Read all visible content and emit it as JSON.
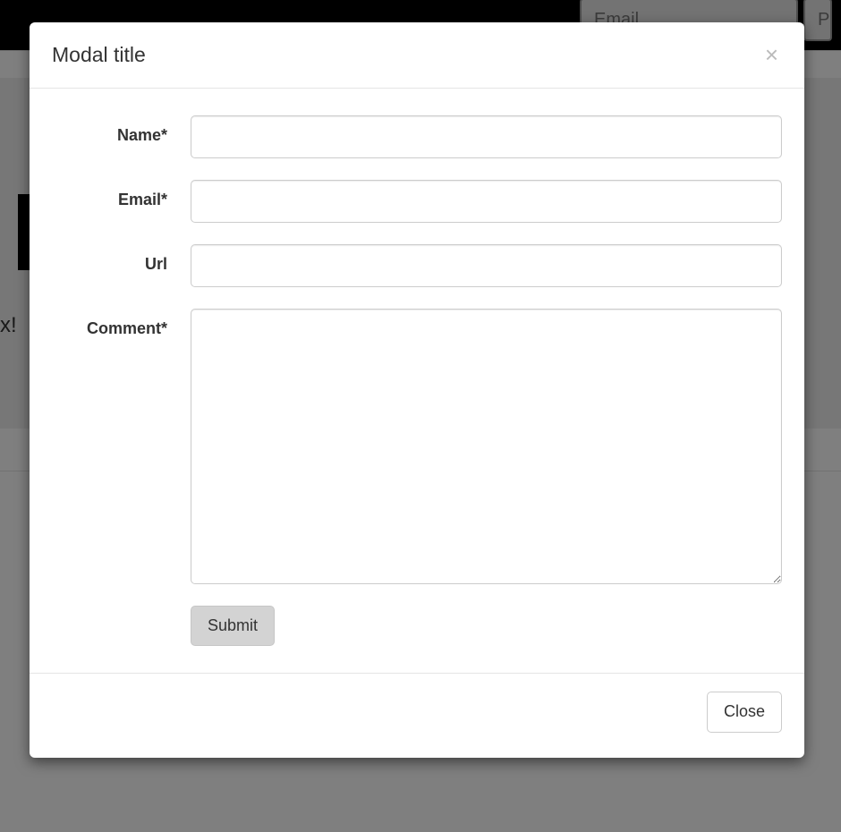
{
  "background": {
    "nav_email_placeholder": "Email",
    "nav_second_placeholder": "P",
    "snippet_text": "x! "
  },
  "modal": {
    "title": "Modal title",
    "close_glyph": "×",
    "fields": {
      "name_label": "Name*",
      "email_label": "Email*",
      "url_label": "Url",
      "comment_label": "Comment*",
      "name_value": "",
      "email_value": "",
      "url_value": "",
      "comment_value": ""
    },
    "submit_label": "Submit",
    "footer_close_label": "Close"
  }
}
